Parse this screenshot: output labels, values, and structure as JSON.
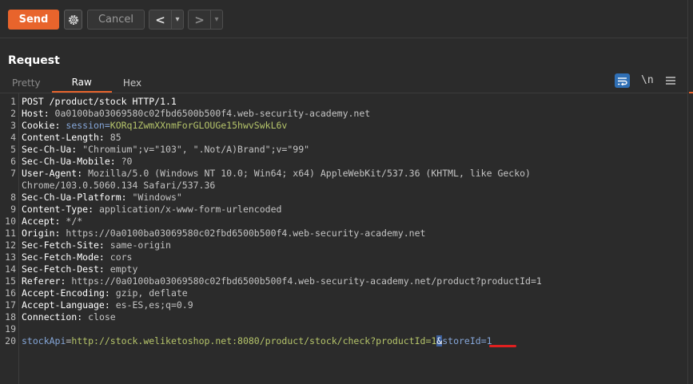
{
  "toolbar": {
    "send_label": "Send",
    "cancel_label": "Cancel",
    "back_glyph": "<",
    "forward_glyph": ">",
    "dropdown_glyph": "▾",
    "settings_icon": "gear-icon"
  },
  "request": {
    "title": "Request",
    "tabs": [
      {
        "label": "Pretty",
        "active": false
      },
      {
        "label": "Raw",
        "active": true
      },
      {
        "label": "Hex",
        "active": false
      }
    ],
    "newline_toggle_label": "\\n"
  },
  "lines": [
    {
      "n": "1",
      "key": "POST /product/stock HTTP/1.1",
      "val": ""
    },
    {
      "n": "2",
      "key": "Host: ",
      "val": "0a0100ba03069580c02fbd6500b500f4.web-security-academy.net"
    },
    {
      "n": "3",
      "key": "Cookie: ",
      "val": "",
      "cookie_name": "session=",
      "cookie_val": "KORq1ZwmXXnmForGLOUGe15hwvSwkL6v"
    },
    {
      "n": "4",
      "key": "Content-Length: ",
      "val": "85"
    },
    {
      "n": "5",
      "key": "Sec-Ch-Ua: ",
      "val": "\"Chromium\";v=\"103\", \".Not/A)Brand\";v=\"99\""
    },
    {
      "n": "6",
      "key": "Sec-Ch-Ua-Mobile: ",
      "val": "?0"
    },
    {
      "n": "7",
      "key": "User-Agent: ",
      "val": "Mozilla/5.0 (Windows NT 10.0; Win64; x64) AppleWebKit/537.36 (KHTML, like Gecko)"
    },
    {
      "n": "",
      "key": "",
      "val": "Chrome/103.0.5060.134 Safari/537.36"
    },
    {
      "n": "8",
      "key": "Sec-Ch-Ua-Platform: ",
      "val": "\"Windows\""
    },
    {
      "n": "9",
      "key": "Content-Type: ",
      "val": "application/x-www-form-urlencoded"
    },
    {
      "n": "10",
      "key": "Accept: ",
      "val": "*/*"
    },
    {
      "n": "11",
      "key": "Origin: ",
      "val": "https://0a0100ba03069580c02fbd6500b500f4.web-security-academy.net"
    },
    {
      "n": "12",
      "key": "Sec-Fetch-Site: ",
      "val": "same-origin"
    },
    {
      "n": "13",
      "key": "Sec-Fetch-Mode: ",
      "val": "cors"
    },
    {
      "n": "14",
      "key": "Sec-Fetch-Dest: ",
      "val": "empty"
    },
    {
      "n": "15",
      "key": "Referer: ",
      "val": "https://0a0100ba03069580c02fbd6500b500f4.web-security-academy.net/product?productId=1"
    },
    {
      "n": "16",
      "key": "Accept-Encoding: ",
      "val": "gzip, deflate"
    },
    {
      "n": "17",
      "key": "Accept-Language: ",
      "val": "es-ES,es;q=0.9"
    },
    {
      "n": "18",
      "key": "Connection: ",
      "val": "close"
    },
    {
      "n": "19",
      "key": "",
      "val": ""
    }
  ],
  "body_line": {
    "n": "20",
    "param1": "stockApi",
    "eq": "=",
    "url": "http://stock.weliketoshop.net:8080/product/stock/check?productId=1",
    "amp": "&",
    "rest": "storeId=1"
  },
  "colors": {
    "send": "#e8642c",
    "active_tab": "#e8642c",
    "highlight": "#3c5f9c",
    "underline": "#e02020"
  }
}
